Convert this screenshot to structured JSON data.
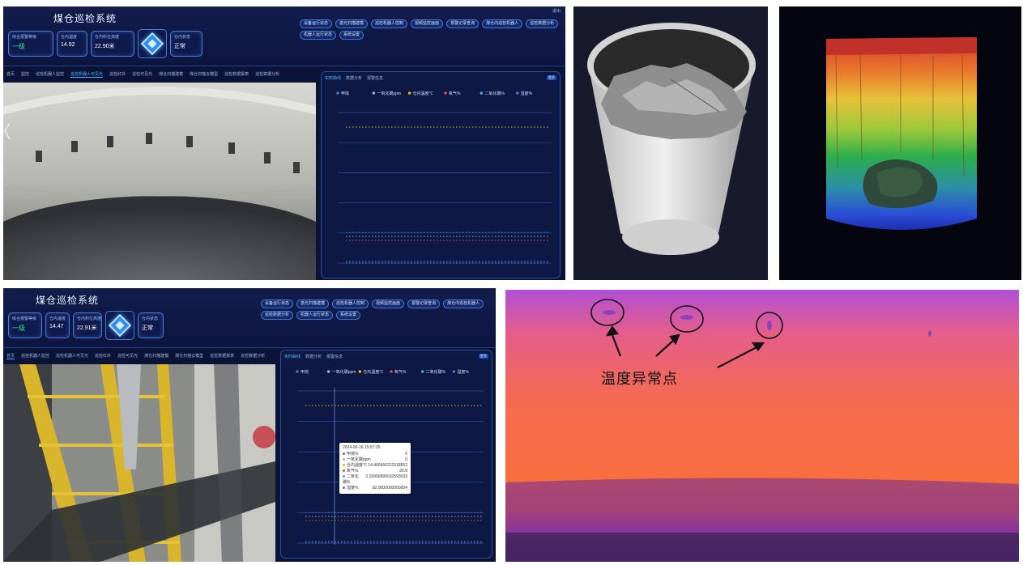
{
  "dashboard": {
    "system_title": "煤仓巡检系统",
    "corner_label": "退出",
    "top": {
      "cards": [
        {
          "label": "综合报警等级",
          "value": "一级",
          "green": true
        },
        {
          "label": "仓内温度",
          "value": "14.92"
        },
        {
          "label": "仓内料位高度",
          "value": "22.90米"
        },
        {
          "label": "仓内状态",
          "value": "正常"
        }
      ],
      "buttons": [
        "设备运行状态",
        "激光扫描建模",
        "巡检机器人控制",
        "视频监控画面",
        "报警记录查询",
        "煤仓内巡检机器人",
        "巡检数据分析",
        "机器人运行状态",
        "系统设置"
      ],
      "tabs": [
        "首页",
        "监控",
        "巡检机器人监控",
        "巡检机器人可见光",
        "巡检红外",
        "巡检可见光",
        "煤仓扫描建模",
        "煤仓扫描云模型",
        "巡检数据报表",
        "巡检数据分析"
      ],
      "chart_tabs": [
        "实时曲线",
        "数据分析",
        "报警信息"
      ],
      "chart_badge": "更多",
      "legend": [
        "甲烷",
        "一氧化碳ppm",
        "仓内温度℃",
        "氧气%",
        "二氧化碳%",
        "湿度%"
      ]
    },
    "bottom": {
      "cards": [
        {
          "label": "综合报警等级",
          "value": "一级",
          "green": true
        },
        {
          "label": "仓内温度",
          "value": "14.47"
        },
        {
          "label": "仓内料位高度",
          "value": "22.91米"
        },
        {
          "label": "仓内状态",
          "value": "正常"
        }
      ],
      "buttons": [
        "设备运行状态",
        "激光扫描建模",
        "巡检机器人控制",
        "视频监控画面",
        "报警记录查询",
        "煤仓内巡检机器人",
        "巡检数据分析",
        "机器人运行状态",
        "系统设置"
      ],
      "tabs": [
        "首页",
        "巡检机器人监控",
        "巡检机器人可见光",
        "巡检红外",
        "巡检可见光",
        "煤仓扫描建模",
        "煤仓扫描云模型",
        "巡检数据报表",
        "巡检数据分析"
      ],
      "chart_tabs": [
        "实时曲线",
        "数据分析",
        "报警信息"
      ],
      "chart_badge": "更多",
      "legend": [
        "甲烷",
        "一氧化碳ppm",
        "仓内温度℃",
        "氧气%",
        "二氧化碳%",
        "湿度%"
      ],
      "tooltip": {
        "time": "2024-06-16 15:57:25",
        "rows": [
          {
            "name": "甲烷%",
            "value": "0",
            "color": "#3a7bd5"
          },
          {
            "name": "一氧化碳ppm",
            "value": "0",
            "color": "#b0b0b0"
          },
          {
            "name": "仓内温度℃",
            "value": "14.466666221618652",
            "color": "#f2b705"
          },
          {
            "name": "氧气%",
            "value": "20.8",
            "color": "#e74c3c"
          },
          {
            "name": "二氧化碳%",
            "value": "0.03999999910593033",
            "color": "#35b5e0"
          },
          {
            "name": "湿度%",
            "value": "82.9000000000004",
            "color": "#5e6ad2"
          }
        ]
      }
    }
  },
  "thermal": {
    "annotation": "温度异常点"
  },
  "colors": {
    "dashboard_bg": "#0b1336",
    "accent": "#5db3ff",
    "card_border": "#4d7bd6",
    "alarm_green": "#35e08a"
  }
}
